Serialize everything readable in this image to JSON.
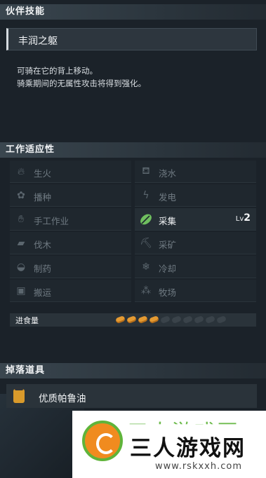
{
  "partner_skill": {
    "header": "伙伴技能",
    "name": "丰润之躯",
    "desc_line1": "可骑在它的背上移动。",
    "desc_line2": "骑乘期间的无属性攻击将得到强化。"
  },
  "work": {
    "header": "工作适应性",
    "items": [
      {
        "label": "生火",
        "icon": "flame-icon",
        "active": false
      },
      {
        "label": "浇水",
        "icon": "watering-can-icon",
        "active": false
      },
      {
        "label": "播种",
        "icon": "sprout-icon",
        "active": false
      },
      {
        "label": "发电",
        "icon": "lightning-icon",
        "active": false
      },
      {
        "label": "手工作业",
        "icon": "hand-icon",
        "active": false
      },
      {
        "label": "采集",
        "icon": "leaf-icon",
        "active": true,
        "level_prefix": "Lv",
        "level": "2"
      },
      {
        "label": "伐木",
        "icon": "log-icon",
        "active": false
      },
      {
        "label": "采矿",
        "icon": "pickaxe-icon",
        "active": false
      },
      {
        "label": "制药",
        "icon": "mortar-icon",
        "active": false
      },
      {
        "label": "冷却",
        "icon": "snowflake-icon",
        "active": false
      },
      {
        "label": "搬运",
        "icon": "box-icon",
        "active": false
      },
      {
        "label": "牧场",
        "icon": "pasture-icon",
        "active": false
      }
    ],
    "active_color": "#7bc86c"
  },
  "food": {
    "label": "进食量",
    "filled": 4,
    "total": 10
  },
  "drops": {
    "header": "掉落道具",
    "items": [
      {
        "name": "优质帕鲁油",
        "icon": "oil-jar-icon"
      }
    ]
  },
  "watermark": {
    "title": "三人游戏网",
    "url": "www.rskxxh.com",
    "top_text": "三人游戏网"
  }
}
